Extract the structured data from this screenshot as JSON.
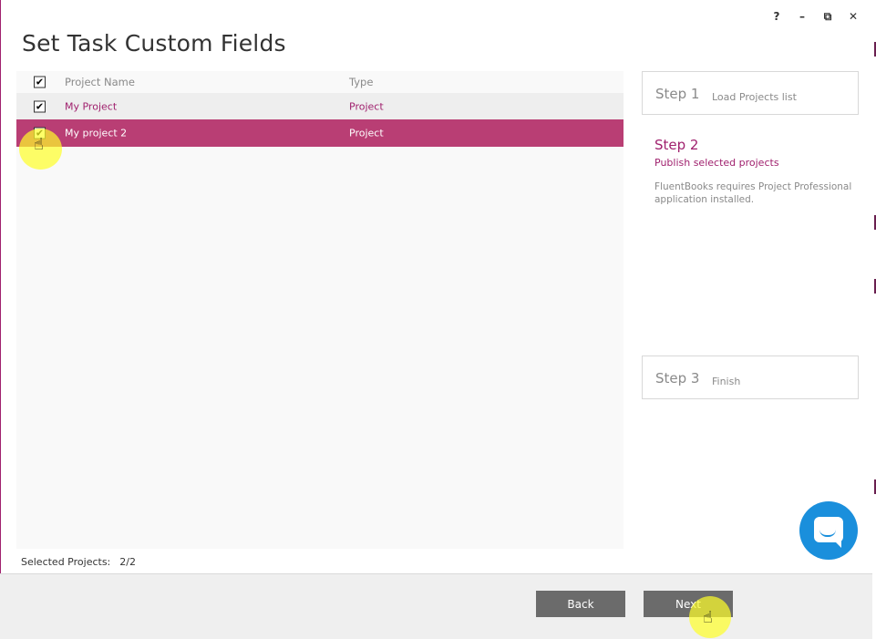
{
  "window": {
    "title": "Set Task Custom Fields",
    "controls": {
      "help": "?",
      "minimize": "–",
      "restore": "⧉",
      "close": "✕"
    }
  },
  "grid": {
    "columns": {
      "name": "Project Name",
      "type": "Type"
    },
    "select_all_checked": true,
    "rows": [
      {
        "name": "My Project",
        "type": "Project",
        "checked": true,
        "selected": false
      },
      {
        "name": "My project 2",
        "type": "Project",
        "checked": true,
        "selected": true
      }
    ]
  },
  "check_glyph": "✔",
  "steps": {
    "step1": {
      "label": "Step 1",
      "text": "Load Projects list"
    },
    "step2": {
      "label": "Step 2",
      "text": "Publish selected projects",
      "note": "FluentBooks requires Project Professional application installed."
    },
    "step3": {
      "label": "Step 3",
      "text": "Finish"
    }
  },
  "status": {
    "label": "Selected Projects:",
    "value": "2/2"
  },
  "footer": {
    "back_label": "Back",
    "next_label": "Next"
  },
  "cursor_glyph": "☝",
  "colors": {
    "accent": "#a0216e",
    "selected_row": "#b93e74",
    "button": "#6b6b6b",
    "chat": "#1a8fdc"
  },
  "icons": {
    "chat": "chat-bubble-icon",
    "cursor": "hand-pointer-icon"
  }
}
